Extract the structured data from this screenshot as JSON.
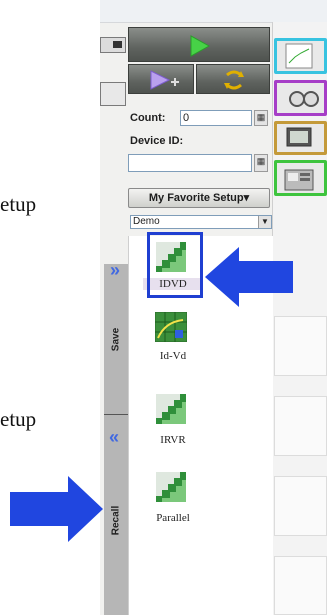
{
  "background": {
    "text_top": "etup",
    "text_bottom": "etup"
  },
  "toolbar": {
    "run_icon": "play-icon",
    "append_icon": "play-append-icon",
    "repeat_icon": "repeat-arrows-icon"
  },
  "count": {
    "label": "Count:",
    "value": "0"
  },
  "device_id": {
    "label": "Device ID:",
    "value": ""
  },
  "favorite": {
    "button_label": "My Favorite Setup",
    "caret": "▾",
    "selected": "Demo"
  },
  "side_tabs": {
    "save_label": "Save",
    "recall_label": "Recall",
    "save_chevron": "»",
    "recall_chevron": "«"
  },
  "setups": [
    {
      "label": "IDVD",
      "icon": "stair-grid-icon"
    },
    {
      "label": "Id-Vd",
      "icon": "grid-curve-icon"
    },
    {
      "label": "IRVR",
      "icon": "stair-grid-icon"
    },
    {
      "label": "Parallel",
      "icon": "stair-grid-icon"
    }
  ],
  "colors": {
    "highlight": "#1f3fd1",
    "arrow": "#2046e0",
    "accent_green": "#3ec43e"
  }
}
